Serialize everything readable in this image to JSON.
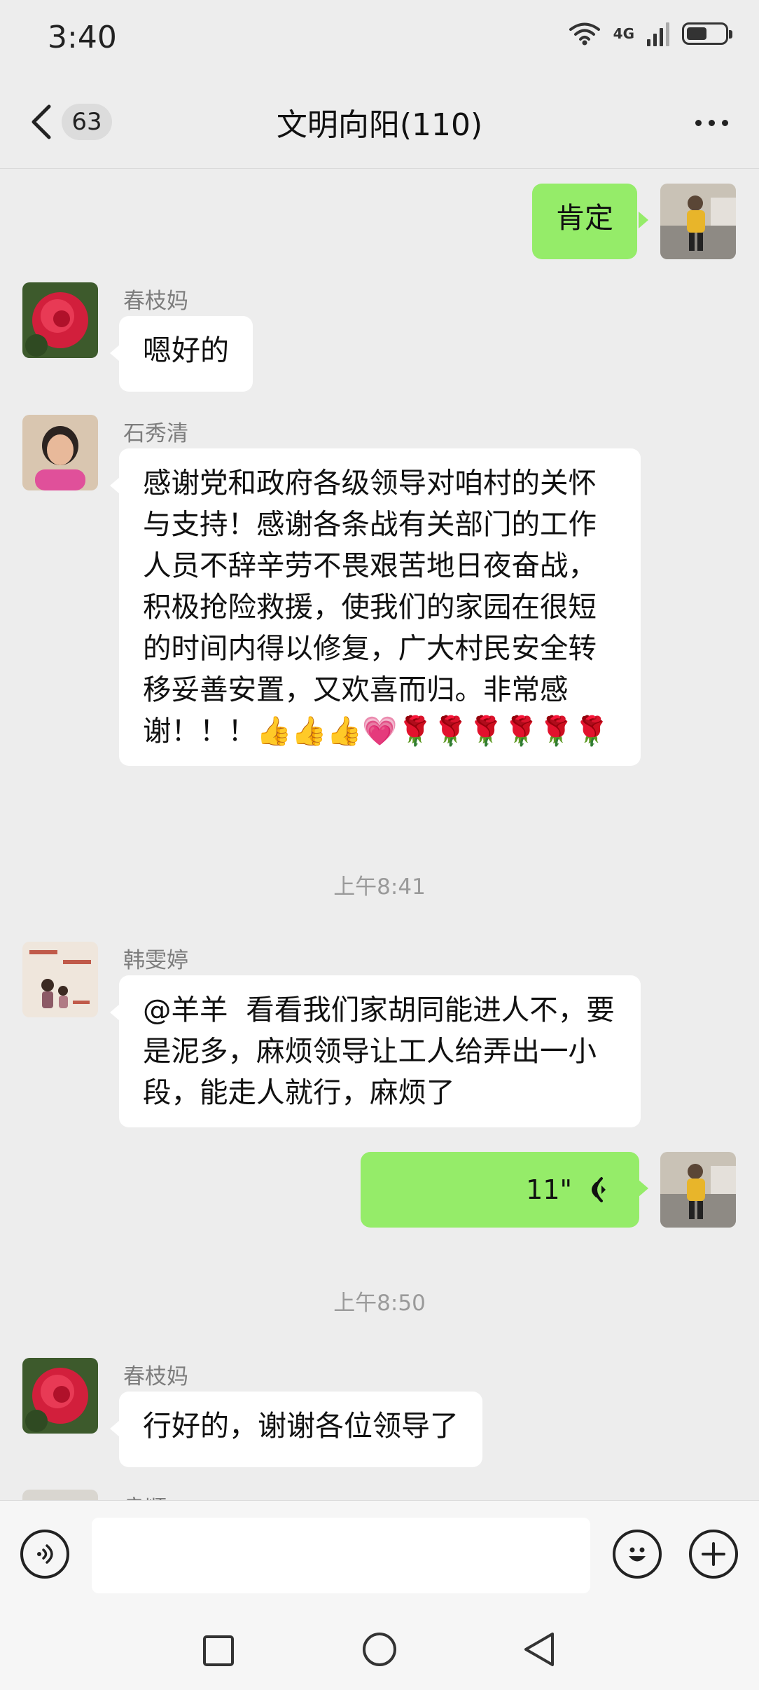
{
  "status_bar": {
    "time": "3:40",
    "network": "4G",
    "wifi_icon": "wifi-icon",
    "signal_icon": "signal-icon",
    "battery_icon": "battery-icon"
  },
  "header": {
    "back_icon": "chevron-left-icon",
    "unread_count": "63",
    "title": "文明向阳(110)",
    "more_icon": "more-dots-icon"
  },
  "messages": [
    {
      "side": "right",
      "text": "肯定"
    },
    {
      "side": "left",
      "sender": "春枝妈",
      "text": "嗯好的"
    },
    {
      "side": "left",
      "sender": "石秀清",
      "text": "感谢党和政府各级领导对咱村的关怀与支持！感谢各条战有关部门的工作人员不辞辛劳不畏艰苦地日夜奋战，积极抢险救援，使我们的家园在很短的时间内得以修复，广大村民安全转移妥善安置，又欢喜而归。非常感谢！！！👍👍👍💗🌹🌹🌹🌹🌹🌹"
    },
    {
      "type": "time",
      "text": "上午8:41"
    },
    {
      "side": "left",
      "sender": "韩雯婷",
      "text": "@羊羊  看看我们家胡同能进人不，要是泥多，麻烦领导让工人给弄出一小段，能走人就行，麻烦了"
    },
    {
      "side": "right",
      "type": "voice",
      "duration": "11\"",
      "icon": "voice-wave-icon"
    },
    {
      "type": "time",
      "text": "上午8:50"
    },
    {
      "side": "left",
      "sender": "春枝妈",
      "text": "行好的，谢谢各位领导了"
    },
    {
      "side": "left",
      "sender": "良顺",
      "partial": true
    }
  ],
  "input_bar": {
    "voice_icon": "voice-input-icon",
    "emoji_icon": "emoji-icon",
    "plus_icon": "plus-icon",
    "placeholder": ""
  },
  "nav_bar": {
    "recents_icon": "square-recents-icon",
    "home_icon": "circle-home-icon",
    "back_icon": "triangle-back-icon"
  },
  "colors": {
    "background": "#ededed",
    "my_bubble": "#95ec69",
    "their_bubble": "#ffffff"
  }
}
